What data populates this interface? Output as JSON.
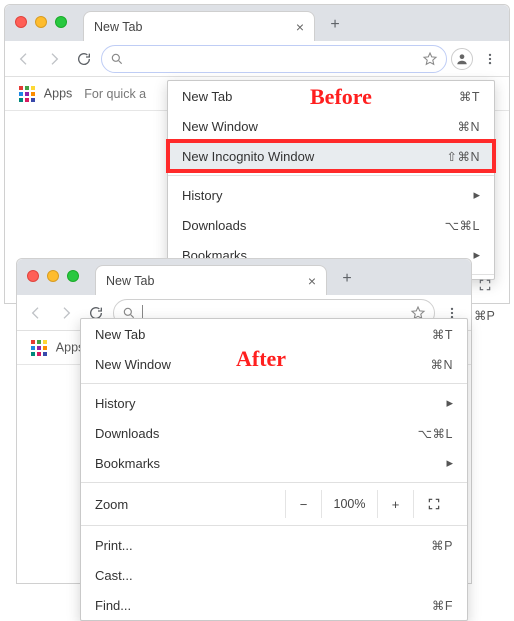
{
  "annotation": {
    "before": "Before",
    "after": "After"
  },
  "browser_a": {
    "tab_title": "New Tab",
    "toolbar": {
      "search_placeholder": ""
    },
    "bookmarks_bar": {
      "apps": "Apps",
      "hint": "For quick a"
    },
    "menu": {
      "new_tab": {
        "label": "New Tab",
        "shortcut": "⌘T"
      },
      "new_window": {
        "label": "New Window",
        "shortcut": "⌘N"
      },
      "new_incognito": {
        "label": "New Incognito Window",
        "shortcut": "⇧⌘N"
      },
      "history": {
        "label": "History"
      },
      "downloads": {
        "label": "Downloads",
        "shortcut": "⌥⌘L"
      },
      "bookmarks": {
        "label": "Bookmarks"
      }
    }
  },
  "browser_b": {
    "tab_title": "New Tab",
    "toolbar": {
      "search_placeholder": ""
    },
    "bookmarks_bar": {
      "apps": "Apps"
    },
    "menu": {
      "new_tab": {
        "label": "New Tab",
        "shortcut": "⌘T"
      },
      "new_window": {
        "label": "New Window",
        "shortcut": "⌘N"
      },
      "history": {
        "label": "History"
      },
      "downloads": {
        "label": "Downloads",
        "shortcut": "⌥⌘L"
      },
      "bookmarks": {
        "label": "Bookmarks"
      },
      "zoom": {
        "label": "Zoom",
        "value": "100%"
      },
      "print": {
        "label": "Print...",
        "shortcut": "⌘P"
      },
      "cast": {
        "label": "Cast..."
      },
      "find": {
        "label": "Find...",
        "shortcut": "⌘F"
      },
      "side_shortcut": "⌘P"
    }
  }
}
